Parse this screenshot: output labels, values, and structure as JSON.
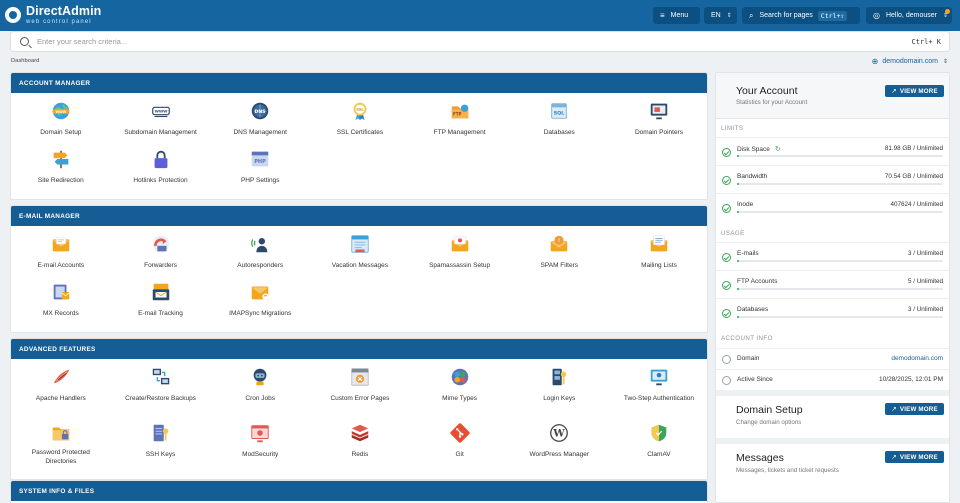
{
  "app": {
    "title": "DirectAdmin",
    "subtitle": "web control panel"
  },
  "topbar": {
    "menu_label": "Menu",
    "lang": "EN",
    "search_pages_label": "Search for pages",
    "search_pages_shortcut": "Ctrl+ Shift+ K",
    "user_label": "Hello, demouser"
  },
  "search": {
    "placeholder": "Enter your search criteria...",
    "shortcut": "Ctrl+ K"
  },
  "breadcrumb": "Dashboard",
  "domain_selector": "demodomain.com",
  "sections": [
    {
      "title": "ACCOUNT MANAGER",
      "items": [
        {
          "label": "Domain Setup",
          "icon": "globe-www-icon"
        },
        {
          "label": "Subdomain Management",
          "icon": "www-bar-icon"
        },
        {
          "label": "DNS Management",
          "icon": "dns-globe-icon"
        },
        {
          "label": "SSL Certificates",
          "icon": "ssl-badge-icon"
        },
        {
          "label": "FTP Management",
          "icon": "ftp-folder-icon"
        },
        {
          "label": "Databases",
          "icon": "sql-database-icon"
        },
        {
          "label": "Domain Pointers",
          "icon": "domain-pointer-icon"
        },
        {
          "label": "Site Redirection",
          "icon": "signpost-icon"
        },
        {
          "label": "Hotlinks Protection",
          "icon": "padlock-icon"
        },
        {
          "label": "PHP Settings",
          "icon": "php-window-icon"
        }
      ]
    },
    {
      "title": "E-MAIL MANAGER",
      "items": [
        {
          "label": "E-mail Accounts",
          "icon": "envelope-icon"
        },
        {
          "label": "Forwarders",
          "icon": "forward-arrow-icon"
        },
        {
          "label": "Autoresponders",
          "icon": "autoresponder-icon"
        },
        {
          "label": "Vacation Messages",
          "icon": "vacation-message-icon"
        },
        {
          "label": "Spamassassin Setup",
          "icon": "spam-envelope-icon"
        },
        {
          "label": "SPAM Filters",
          "icon": "spam-filter-icon"
        },
        {
          "label": "Mailing Lists",
          "icon": "mailing-list-icon"
        },
        {
          "label": "MX Records",
          "icon": "mx-records-icon"
        },
        {
          "label": "E-mail Tracking",
          "icon": "email-tracking-icon"
        },
        {
          "label": "IMAPSync Migrations",
          "icon": "imap-sync-icon"
        }
      ]
    },
    {
      "title": "ADVANCED FEATURES",
      "items": [
        {
          "label": "Apache Handlers",
          "icon": "apache-feather-icon"
        },
        {
          "label": "Create/Restore Backups",
          "icon": "backup-icon"
        },
        {
          "label": "Cron Jobs",
          "icon": "cron-robot-icon"
        },
        {
          "label": "Custom Error Pages",
          "icon": "error-page-icon"
        },
        {
          "label": "Mime Types",
          "icon": "mime-types-icon"
        },
        {
          "label": "Login Keys",
          "icon": "login-keys-icon"
        },
        {
          "label": "Two-Step Authentication",
          "icon": "two-step-auth-icon"
        },
        {
          "label": "Password Protected Directories",
          "icon": "protected-folder-icon"
        },
        {
          "label": "SSH Keys",
          "icon": "ssh-keys-icon"
        },
        {
          "label": "ModSecurity",
          "icon": "modsecurity-icon"
        },
        {
          "label": "Redis",
          "icon": "redis-icon"
        },
        {
          "label": "Git",
          "icon": "git-icon"
        },
        {
          "label": "WordPress Manager",
          "icon": "wordpress-icon"
        },
        {
          "label": "ClamAV",
          "icon": "clamav-shield-icon"
        }
      ]
    },
    {
      "title": "SYSTEM INFO & FILES",
      "items": []
    }
  ],
  "account": {
    "title": "Your Account",
    "subtitle": "Statistics for your Account",
    "view_more": "VIEW MORE",
    "limits_label": "LIMITS",
    "limits": [
      {
        "name": "Disk Space",
        "value": "81.98 GB / Unlimited",
        "fill": 0.01
      },
      {
        "name": "Bandwidth",
        "value": "70.54 GB / Unlimited",
        "fill": 0.01
      },
      {
        "name": "Inode",
        "value": "407624 / Unlimited",
        "fill": 0.01
      }
    ],
    "usage_label": "USAGE",
    "usage": [
      {
        "name": "E-mails",
        "value": "3 / Unlimited",
        "fill": 0.01
      },
      {
        "name": "FTP Accounts",
        "value": "5 / Unlimited",
        "fill": 0.01
      },
      {
        "name": "Databases",
        "value": "3 / Unlimited",
        "fill": 0.01
      }
    ],
    "info_label": "ACCOUNT INFO",
    "info": [
      {
        "name": "Domain",
        "value": "demodomain.com"
      },
      {
        "name": "Active Since",
        "value": "10/28/2025, 12:01 PM"
      }
    ]
  },
  "domain_card": {
    "title": "Domain Setup",
    "subtitle": "Change domain options",
    "view_more": "VIEW MORE"
  },
  "messages_card": {
    "title": "Messages",
    "subtitle": "Messages, tickets and ticket requests",
    "view_more": "VIEW MORE"
  },
  "colors": {
    "primary": "#145e95",
    "topbar": "#1465a0",
    "success": "#3aa657",
    "accent_orange": "#f3a61c"
  }
}
